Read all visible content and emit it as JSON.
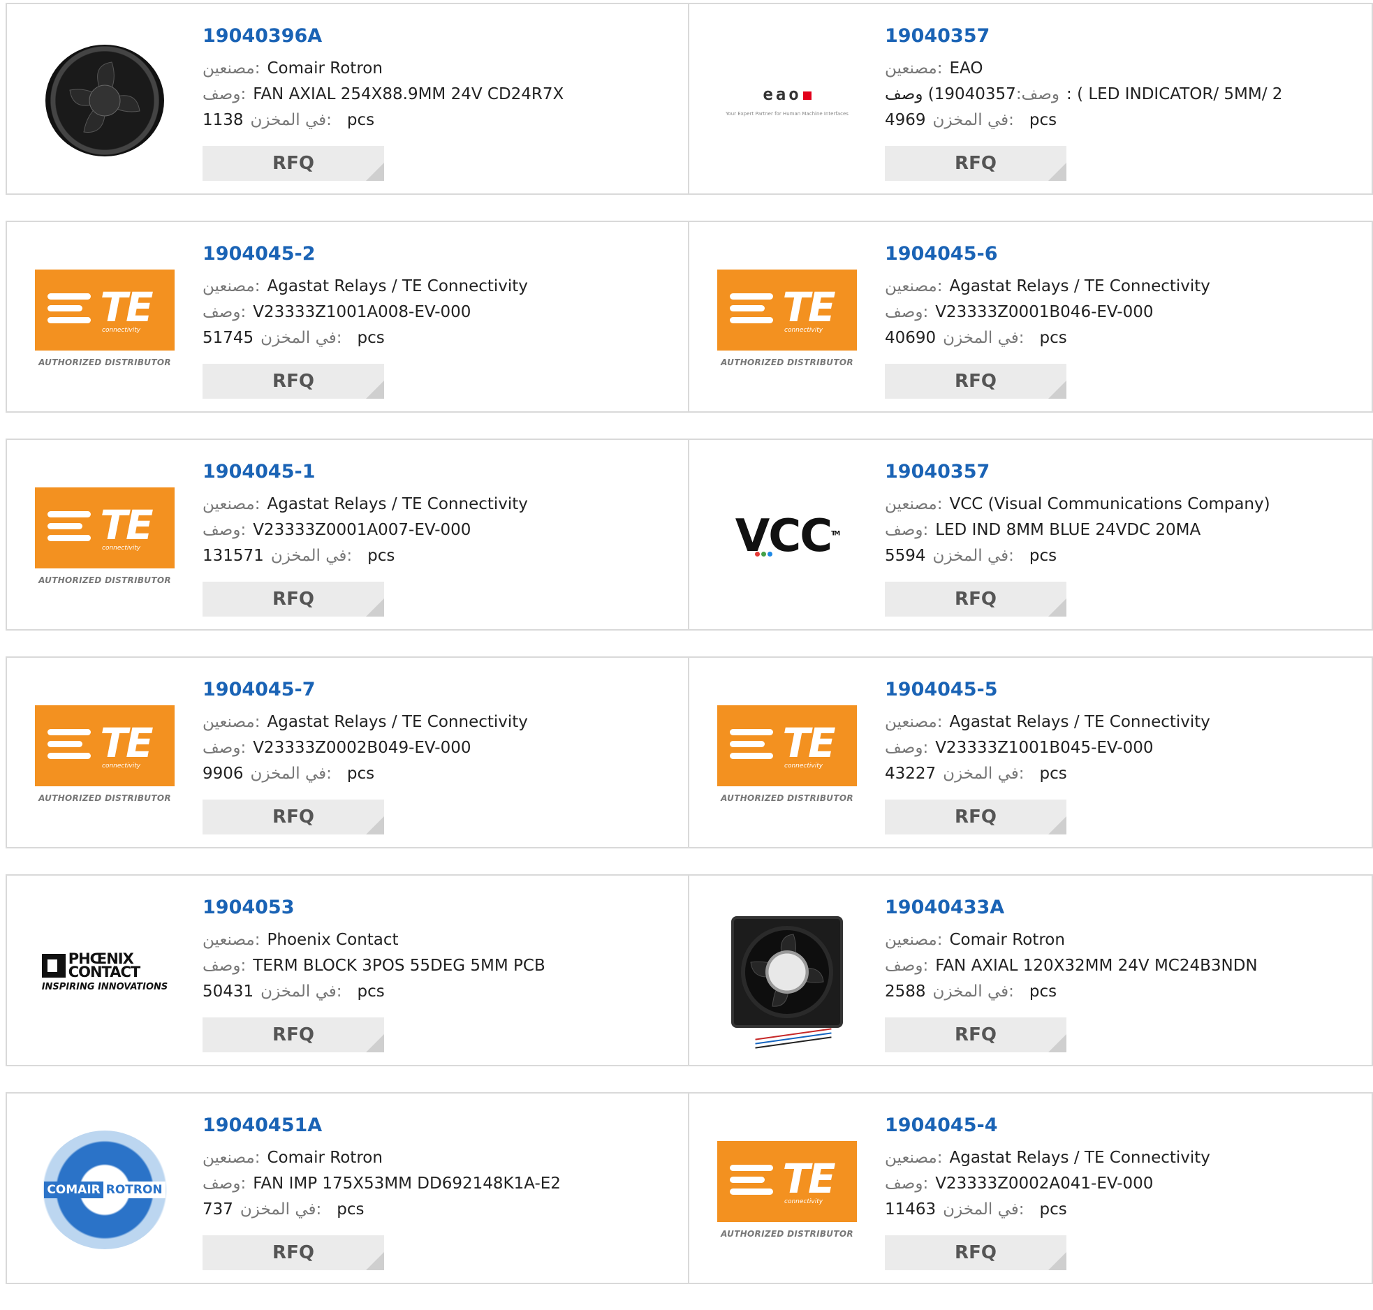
{
  "labels": {
    "manufacturer": "مصنعين:",
    "description": "وصف:",
    "stock": "في المخزن:",
    "unit": "pcs",
    "rfq": "RFQ"
  },
  "logos": {
    "te_text": "TE",
    "te_sub": "connectivity",
    "te_authorized": "AUTHORIZED DISTRIBUTOR",
    "eao_word": "eao",
    "eao_sub": "Your Expert Partner for Human Machine Interfaces",
    "vcc_word": "VCC",
    "vcc_tm": "TM",
    "phoenix_line1": "PHŒNIX",
    "phoenix_line2": "CONTACT",
    "phoenix_tag": "INSPIRING INNOVATIONS",
    "comair_left": "COMAIR",
    "comair_right": "ROTRON"
  },
  "colors": {
    "part_link": "#1a63b5",
    "te_orange": "#f39120",
    "eao_red": "#e2001a",
    "comair_blue": "#2b73c8"
  },
  "products": [
    {
      "part": "19040396A",
      "manufacturer": "Comair Rotron",
      "description": "FAN AXIAL 254X88.9MM 24V CD24R7X",
      "stock": "1138",
      "logo": "fan-round"
    },
    {
      "part": "19040357",
      "manufacturer": "EAO",
      "description": "19040357)  وصف: ( LED INDICATOR/ 5MM/ 2",
      "stock": "4969",
      "logo": "eao"
    },
    {
      "part": "1904045-2",
      "manufacturer": "Agastat Relays / TE Connectivity",
      "description": "V23333Z1001A008-EV-000",
      "stock": "51745",
      "logo": "te"
    },
    {
      "part": "1904045-6",
      "manufacturer": "Agastat Relays / TE Connectivity",
      "description": "V23333Z0001B046-EV-000",
      "stock": "40690",
      "logo": "te"
    },
    {
      "part": "1904045-1",
      "manufacturer": "Agastat Relays / TE Connectivity",
      "description": "V23333Z0001A007-EV-000",
      "stock": "131571",
      "logo": "te"
    },
    {
      "part": "19040357",
      "manufacturer": "VCC (Visual Communications Company)",
      "description": "LED IND 8MM BLUE 24VDC 20MA",
      "stock": "5594",
      "logo": "vcc"
    },
    {
      "part": "1904045-7",
      "manufacturer": "Agastat Relays / TE Connectivity",
      "description": "V23333Z0002B049-EV-000",
      "stock": "9906",
      "logo": "te"
    },
    {
      "part": "1904045-5",
      "manufacturer": "Agastat Relays / TE Connectivity",
      "description": "V23333Z1001B045-EV-000",
      "stock": "43227",
      "logo": "te"
    },
    {
      "part": "1904053",
      "manufacturer": "Phoenix Contact",
      "description": "TERM BLOCK 3POS 55DEG 5MM PCB",
      "stock": "50431",
      "logo": "phoenix"
    },
    {
      "part": "19040433A",
      "manufacturer": "Comair Rotron",
      "description": "FAN AXIAL 120X32MM 24V MC24B3NDN",
      "stock": "2588",
      "logo": "fan-square"
    },
    {
      "part": "19040451A",
      "manufacturer": "Comair Rotron",
      "description": "FAN IMP 175X53MM DD692148K1A-E2",
      "stock": "737",
      "logo": "comair"
    },
    {
      "part": "1904045-4",
      "manufacturer": "Agastat Relays / TE Connectivity",
      "description": "V23333Z0002A041-EV-000",
      "stock": "11463",
      "logo": "te"
    }
  ]
}
